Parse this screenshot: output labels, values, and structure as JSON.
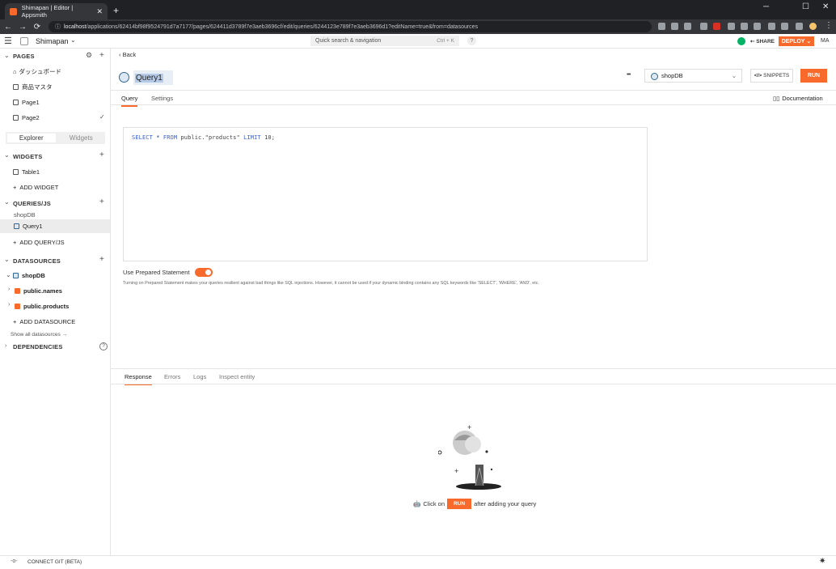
{
  "browser": {
    "tab_title": "Shimapan | Editor | Appsmith",
    "new_tab": "+",
    "url_host": "localhost",
    "url_path": "/applications/62414bf98f9524791d7a7177/pages/624411d3789f7e3aeb3696cf/edit/queries/6244123e789f7e3aeb3696d1?editName=true&from=datasources"
  },
  "app": {
    "name": "Shimapan",
    "search_placeholder": "Quick search & navigation",
    "search_shortcut": "Ctrl + K",
    "help": "?",
    "share": "SHARE",
    "deploy": "DEPLOY",
    "avatar": "MA"
  },
  "sidebar": {
    "pages_title": "PAGES",
    "pages": [
      "ダッシュボード",
      "商品マスタ",
      "Page1",
      "Page2"
    ],
    "toggle": {
      "explorer": "Explorer",
      "widgets": "Widgets"
    },
    "widgets_title": "WIDGETS",
    "widgets": [
      "Table1"
    ],
    "add_widget": "ADD WIDGET",
    "queries_title": "QUERIES/JS",
    "query_group": "shopDB",
    "queries": [
      "Query1"
    ],
    "add_query": "ADD QUERY/JS",
    "datasources_title": "DATASOURCES",
    "datasource": "shopDB",
    "tables": [
      "public.names",
      "public.products"
    ],
    "add_datasource": "ADD DATASOURCE",
    "show_all": "Show all datasources",
    "dependencies_title": "DEPENDENCIES"
  },
  "editor": {
    "back": "Back",
    "query_name": "Query1",
    "more": "•••",
    "datasource_selected": "shopDB",
    "snippets": "SNIPPETS",
    "run": "RUN",
    "tabs": [
      "Query",
      "Settings"
    ],
    "documentation": "Documentation",
    "sql_kw1": "SELECT",
    "sql_star": "*",
    "sql_kw2": "FROM",
    "sql_table": "public.\"products\"",
    "sql_kw3": "LIMIT",
    "sql_num": "10;",
    "prepared_label": "Use Prepared Statement",
    "prepared_desc": "Turning on Prepared Statement makes your queries resilient against bad things like SQL injections. However, it cannot be used if your dynamic binding contains any SQL keywords like 'SELECT', 'WHERE', 'AND', etc."
  },
  "response": {
    "tabs": [
      "Response",
      "Errors",
      "Logs",
      "Inspect entity"
    ],
    "hint_prefix": "Click on",
    "hint_button": "RUN",
    "hint_suffix": "after adding your query"
  },
  "footer": {
    "connect_git": "CONNECT GIT (BETA)"
  },
  "colors": {
    "accent": "#f86a2b"
  }
}
